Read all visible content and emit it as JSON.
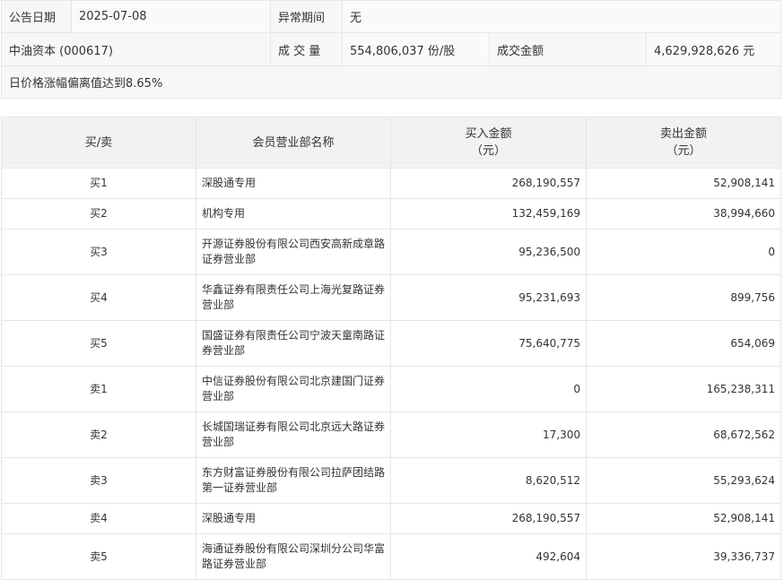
{
  "summary": {
    "date_label": "公告日期",
    "date_value": "2025-07-08",
    "period_label": "异常期间",
    "period_value": "无",
    "stock": "中油资本 (000617)",
    "volume_label": "成 交 量",
    "volume_value": "554,806,037 份/股",
    "amount_label": "成交金额",
    "amount_value": "4,629,928,626 元",
    "reason": "日价格涨幅偏离值达到8.65%"
  },
  "table": {
    "headers": {
      "side": "买/卖",
      "name": "会员营业部名称",
      "buy_line1": "买入金额",
      "buy_line2": "（元）",
      "sell_line1": "卖出金额",
      "sell_line2": "（元）"
    },
    "rows": [
      {
        "side": "买1",
        "name": "深股通专用",
        "buy": "268,190,557",
        "sell": "52,908,141"
      },
      {
        "side": "买2",
        "name": "机构专用",
        "buy": "132,459,169",
        "sell": "38,994,660"
      },
      {
        "side": "买3",
        "name": "开源证券股份有限公司西安高新成章路证券营业部",
        "buy": "95,236,500",
        "sell": "0"
      },
      {
        "side": "买4",
        "name": "华鑫证券有限责任公司上海光复路证券营业部",
        "buy": "95,231,693",
        "sell": "899,756"
      },
      {
        "side": "买5",
        "name": "国盛证券有限责任公司宁波天童南路证券营业部",
        "buy": "75,640,775",
        "sell": "654,069"
      },
      {
        "side": "卖1",
        "name": "中信证券股份有限公司北京建国门证券营业部",
        "buy": "0",
        "sell": "165,238,311"
      },
      {
        "side": "卖2",
        "name": "长城国瑞证券有限公司北京远大路证券营业部",
        "buy": "17,300",
        "sell": "68,672,562"
      },
      {
        "side": "卖3",
        "name": "东方财富证券股份有限公司拉萨团结路第一证券营业部",
        "buy": "8,620,512",
        "sell": "55,293,624"
      },
      {
        "side": "卖4",
        "name": "深股通专用",
        "buy": "268,190,557",
        "sell": "52,908,141"
      },
      {
        "side": "卖5",
        "name": "海通证券股份有限公司深圳分公司华富路证券营业部",
        "buy": "492,604",
        "sell": "39,336,737"
      }
    ]
  }
}
